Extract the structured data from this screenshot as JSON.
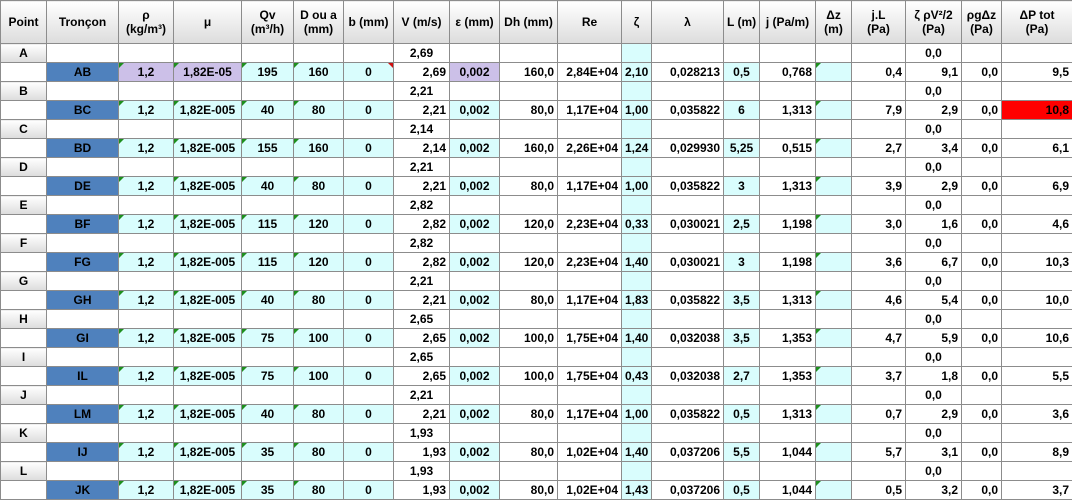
{
  "headers": [
    {
      "l1": "Point",
      "l2": ""
    },
    {
      "l1": "Tronçon",
      "l2": ""
    },
    {
      "l1": "ρ",
      "l2": "(kg/m³)"
    },
    {
      "l1": "μ",
      "l2": ""
    },
    {
      "l1": "Qv",
      "l2": "(m³/h)"
    },
    {
      "l1": "D ou a",
      "l2": "(mm)"
    },
    {
      "l1": "b (mm)",
      "l2": ""
    },
    {
      "l1": "V (m/s)",
      "l2": ""
    },
    {
      "l1": "ε (mm)",
      "l2": ""
    },
    {
      "l1": "Dh (mm)",
      "l2": ""
    },
    {
      "l1": "Re",
      "l2": ""
    },
    {
      "l1": "ζ",
      "l2": ""
    },
    {
      "l1": "λ",
      "l2": ""
    },
    {
      "l1": "L (m)",
      "l2": ""
    },
    {
      "l1": "j (Pa/m)",
      "l2": ""
    },
    {
      "l1": "Δz",
      "l2": "(m)"
    },
    {
      "l1": "j.L",
      "l2": "(Pa)"
    },
    {
      "l1": "ζ ρV²/2",
      "l2": "(Pa)"
    },
    {
      "l1": "ρgΔz",
      "l2": "(Pa)"
    },
    {
      "l1": "ΔP tot",
      "l2": "(Pa)"
    }
  ],
  "points": [
    {
      "point": "A",
      "v": "2,69",
      "dyn": "0,0"
    },
    {
      "point": "B",
      "v": "2,21",
      "dyn": "0,0"
    },
    {
      "point": "C",
      "v": "2,14",
      "dyn": "0,0"
    },
    {
      "point": "D",
      "v": "2,21",
      "dyn": "0,0"
    },
    {
      "point": "E",
      "v": "2,82",
      "dyn": "0,0"
    },
    {
      "point": "F",
      "v": "2,82",
      "dyn": "0,0"
    },
    {
      "point": "G",
      "v": "2,21",
      "dyn": "0,0"
    },
    {
      "point": "H",
      "v": "2,65",
      "dyn": "0,0"
    },
    {
      "point": "I",
      "v": "2,65",
      "dyn": "0,0"
    },
    {
      "point": "J",
      "v": "2,21",
      "dyn": "0,0"
    },
    {
      "point": "K",
      "v": "1,93",
      "dyn": "0,0"
    },
    {
      "point": "L",
      "v": "1,93",
      "dyn": "0,0"
    }
  ],
  "segments": [
    {
      "name": "AB",
      "rho": "1,2",
      "mu": "1,82E-05",
      "qv": "195",
      "d": "160",
      "b": "0",
      "v": "2,69",
      "eps": "0,002",
      "dh": "160,0",
      "re": "2,84E+04",
      "zeta": "2,10",
      "lambda": "0,028213",
      "l": "0,5",
      "j": "0,768",
      "dz": "",
      "jl": "0,4",
      "dyn": "9,1",
      "rgdz": "0,0",
      "dp": "9,5"
    },
    {
      "name": "BC",
      "rho": "1,2",
      "mu": "1,82E-005",
      "qv": "40",
      "d": "80",
      "b": "0",
      "v": "2,21",
      "eps": "0,002",
      "dh": "80,0",
      "re": "1,17E+04",
      "zeta": "1,00",
      "lambda": "0,035822",
      "l": "6",
      "j": "1,313",
      "dz": "",
      "jl": "7,9",
      "dyn": "2,9",
      "rgdz": "0,0",
      "dp": "10,8"
    },
    {
      "name": "BD",
      "rho": "1,2",
      "mu": "1,82E-005",
      "qv": "155",
      "d": "160",
      "b": "0",
      "v": "2,14",
      "eps": "0,002",
      "dh": "160,0",
      "re": "2,26E+04",
      "zeta": "1,24",
      "lambda": "0,029930",
      "l": "5,25",
      "j": "0,515",
      "dz": "",
      "jl": "2,7",
      "dyn": "3,4",
      "rgdz": "0,0",
      "dp": "6,1"
    },
    {
      "name": "DE",
      "rho": "1,2",
      "mu": "1,82E-005",
      "qv": "40",
      "d": "80",
      "b": "0",
      "v": "2,21",
      "eps": "0,002",
      "dh": "80,0",
      "re": "1,17E+04",
      "zeta": "1,00",
      "lambda": "0,035822",
      "l": "3",
      "j": "1,313",
      "dz": "",
      "jl": "3,9",
      "dyn": "2,9",
      "rgdz": "0,0",
      "dp": "6,9"
    },
    {
      "name": "BF",
      "rho": "1,2",
      "mu": "1,82E-005",
      "qv": "115",
      "d": "120",
      "b": "0",
      "v": "2,82",
      "eps": "0,002",
      "dh": "120,0",
      "re": "2,23E+04",
      "zeta": "0,33",
      "lambda": "0,030021",
      "l": "2,5",
      "j": "1,198",
      "dz": "",
      "jl": "3,0",
      "dyn": "1,6",
      "rgdz": "0,0",
      "dp": "4,6"
    },
    {
      "name": "FG",
      "rho": "1,2",
      "mu": "1,82E-005",
      "qv": "115",
      "d": "120",
      "b": "0",
      "v": "2,82",
      "eps": "0,002",
      "dh": "120,0",
      "re": "2,23E+04",
      "zeta": "1,40",
      "lambda": "0,030021",
      "l": "3",
      "j": "1,198",
      "dz": "",
      "jl": "3,6",
      "dyn": "6,7",
      "rgdz": "0,0",
      "dp": "10,3"
    },
    {
      "name": "GH",
      "rho": "1,2",
      "mu": "1,82E-005",
      "qv": "40",
      "d": "80",
      "b": "0",
      "v": "2,21",
      "eps": "0,002",
      "dh": "80,0",
      "re": "1,17E+04",
      "zeta": "1,83",
      "lambda": "0,035822",
      "l": "3,5",
      "j": "1,313",
      "dz": "",
      "jl": "4,6",
      "dyn": "5,4",
      "rgdz": "0,0",
      "dp": "10,0"
    },
    {
      "name": "GI",
      "rho": "1,2",
      "mu": "1,82E-005",
      "qv": "75",
      "d": "100",
      "b": "0",
      "v": "2,65",
      "eps": "0,002",
      "dh": "100,0",
      "re": "1,75E+04",
      "zeta": "1,40",
      "lambda": "0,032038",
      "l": "3,5",
      "j": "1,353",
      "dz": "",
      "jl": "4,7",
      "dyn": "5,9",
      "rgdz": "0,0",
      "dp": "10,6"
    },
    {
      "name": "IL",
      "rho": "1,2",
      "mu": "1,82E-005",
      "qv": "75",
      "d": "100",
      "b": "0",
      "v": "2,65",
      "eps": "0,002",
      "dh": "100,0",
      "re": "1,75E+04",
      "zeta": "0,43",
      "lambda": "0,032038",
      "l": "2,7",
      "j": "1,353",
      "dz": "",
      "jl": "3,7",
      "dyn": "1,8",
      "rgdz": "0,0",
      "dp": "5,5"
    },
    {
      "name": "LM",
      "rho": "1,2",
      "mu": "1,82E-005",
      "qv": "40",
      "d": "80",
      "b": "0",
      "v": "2,21",
      "eps": "0,002",
      "dh": "80,0",
      "re": "1,17E+04",
      "zeta": "1,00",
      "lambda": "0,035822",
      "l": "0,5",
      "j": "1,313",
      "dz": "",
      "jl": "0,7",
      "dyn": "2,9",
      "rgdz": "0,0",
      "dp": "3,6"
    },
    {
      "name": "IJ",
      "rho": "1,2",
      "mu": "1,82E-005",
      "qv": "35",
      "d": "80",
      "b": "0",
      "v": "1,93",
      "eps": "0,002",
      "dh": "80,0",
      "re": "1,02E+04",
      "zeta": "1,40",
      "lambda": "0,037206",
      "l": "5,5",
      "j": "1,044",
      "dz": "",
      "jl": "5,7",
      "dyn": "3,1",
      "rgdz": "0,0",
      "dp": "8,9"
    },
    {
      "name": "JK",
      "rho": "1,2",
      "mu": "1,82E-005",
      "qv": "35",
      "d": "80",
      "b": "0",
      "v": "1,93",
      "eps": "0,002",
      "dh": "80,0",
      "re": "1,02E+04",
      "zeta": "1,43",
      "lambda": "0,037206",
      "l": "0,5",
      "j": "1,044",
      "dz": "",
      "jl": "0,5",
      "dyn": "3,2",
      "rgdz": "0,0",
      "dp": "3,7"
    }
  ],
  "colors": {
    "segment_fill": "#4f81bd",
    "input_fill": "#d9fdfd",
    "selected_fill": "#ccc0e8",
    "alert_fill": "#ff0000"
  }
}
